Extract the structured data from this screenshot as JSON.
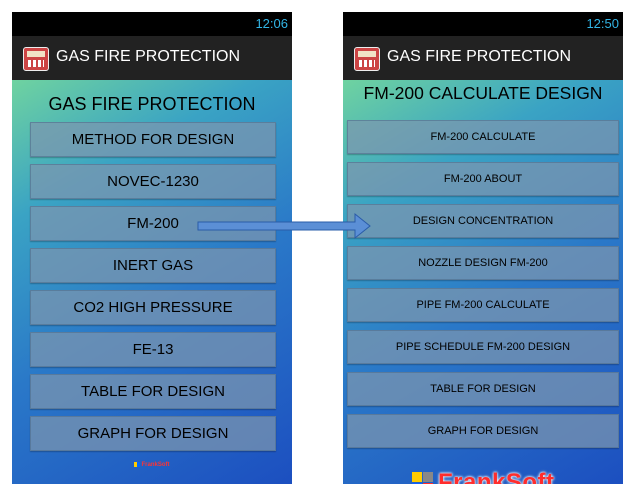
{
  "left": {
    "status_time": "12:06",
    "app_title": "GAS FIRE PROTECTION",
    "heading": "GAS FIRE PROTECTION",
    "buttons": [
      "METHOD FOR DESIGN",
      "NOVEC-1230",
      "FM-200",
      "INERT GAS",
      "CO2 HIGH PRESSURE",
      "FE-13",
      "TABLE FOR DESIGN",
      "GRAPH FOR DESIGN"
    ],
    "brand": "FrankSoft"
  },
  "right": {
    "status_time": "12:50",
    "app_title": "GAS FIRE PROTECTION",
    "heading": "FM-200 CALCULATE DESIGN",
    "buttons": [
      "FM-200 CALCULATE",
      "FM-200 ABOUT",
      "DESIGN CONCENTRATION",
      "NOZZLE DESIGN FM-200",
      "PIPE FM-200 CALCULATE",
      "PIPE SCHEDULE FM-200 DESIGN",
      "TABLE FOR DESIGN",
      "GRAPH FOR DESIGN"
    ],
    "brand": "FrankSoft"
  },
  "colors": {
    "status_time": "#33b5e5",
    "action_bar": "#222222",
    "button_bg": "#7d96af",
    "brand": "#ff2d2d",
    "arrow": "#5b8fd6"
  },
  "icons": {
    "app": "fire-extinguisher-app-icon",
    "transition": "right-arrow-icon"
  }
}
